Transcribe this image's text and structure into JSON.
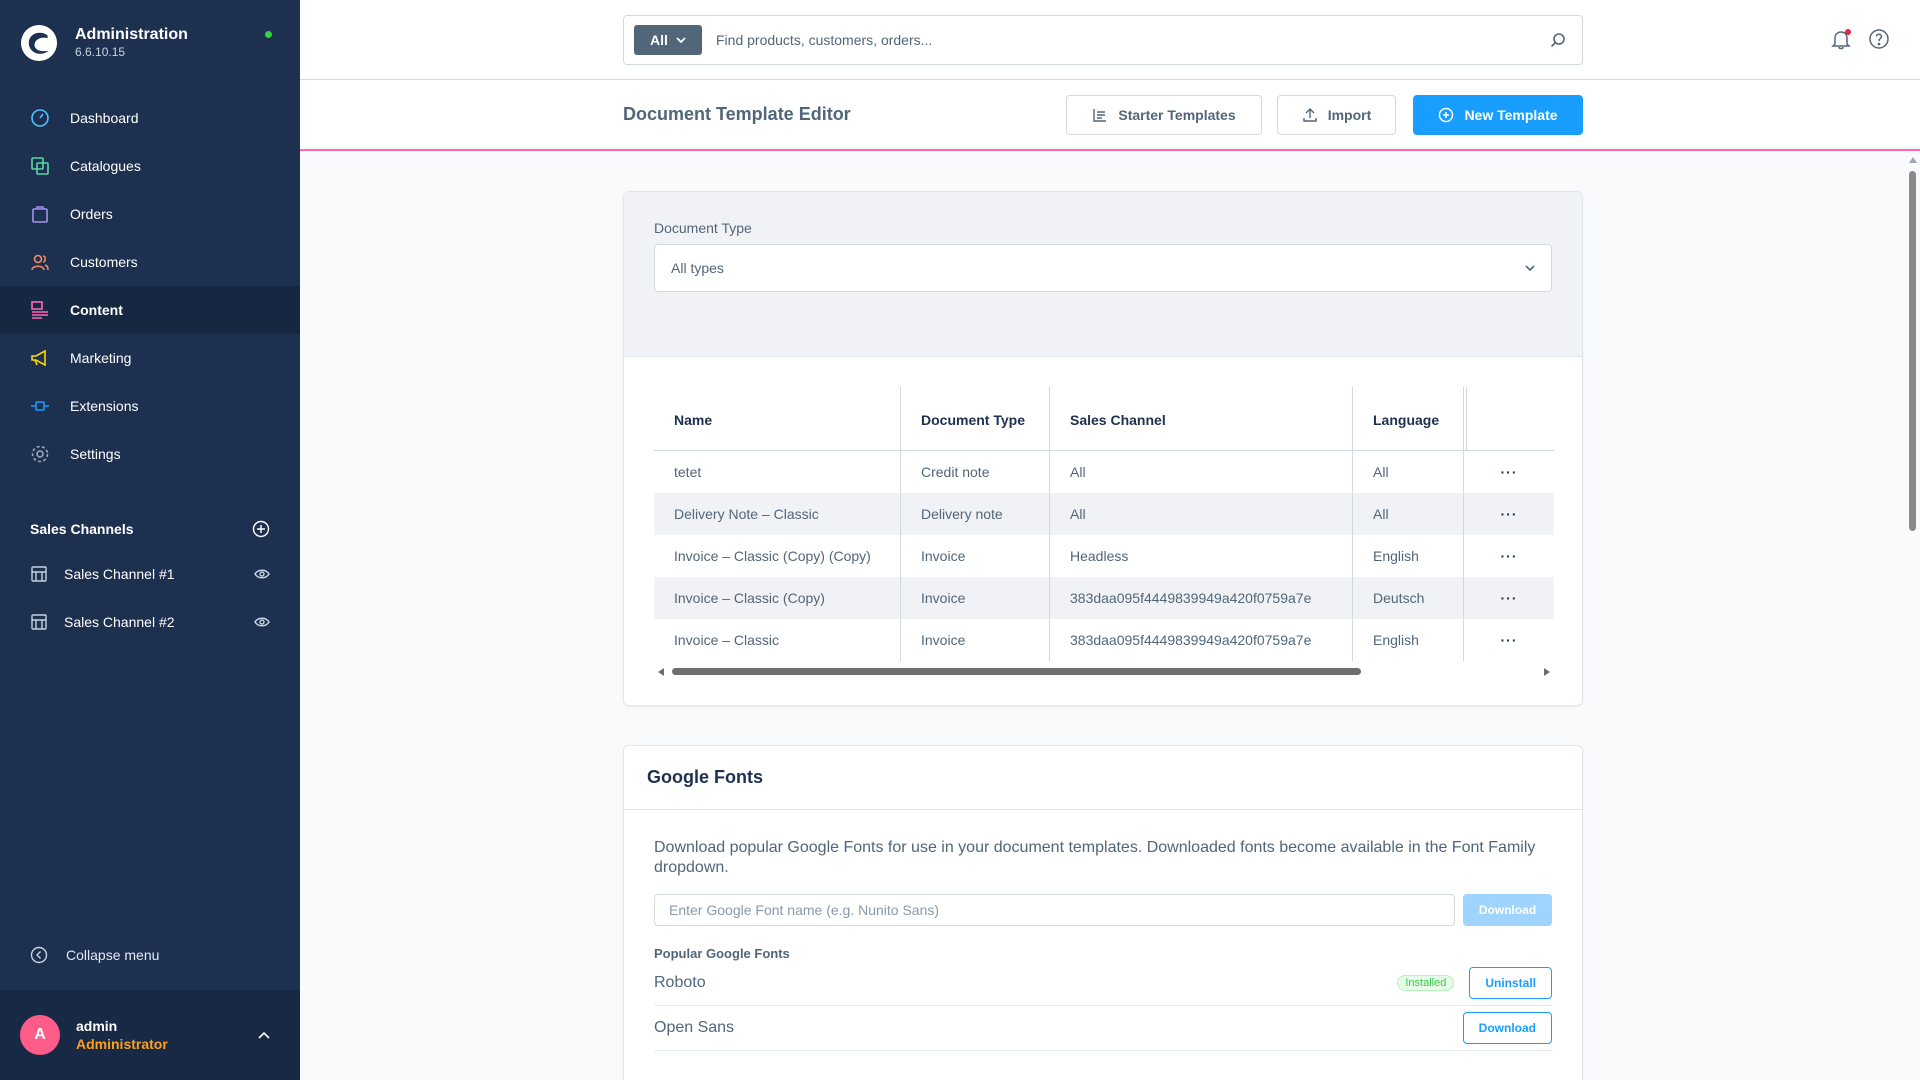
{
  "app": {
    "title": "Administration",
    "version": "6.6.10.15"
  },
  "nav": [
    {
      "label": "Dashboard",
      "icon": "gauge-icon",
      "color": "#4fc3ff"
    },
    {
      "label": "Catalogues",
      "icon": "products-icon",
      "color": "#57d9a3"
    },
    {
      "label": "Orders",
      "icon": "shopping-bag-icon",
      "color": "#a092f0"
    },
    {
      "label": "Customers",
      "icon": "users-icon",
      "color": "#f88962"
    },
    {
      "label": "Content",
      "icon": "content-icon",
      "color": "#ff68b4",
      "active": true
    },
    {
      "label": "Marketing",
      "icon": "megaphone-icon",
      "color": "#ffd700"
    },
    {
      "label": "Extensions",
      "icon": "plug-icon",
      "color": "#189eff"
    },
    {
      "label": "Settings",
      "icon": "gear-icon",
      "color": "#9aa8b5"
    }
  ],
  "sales_channels": {
    "title": "Sales Channels",
    "items": [
      {
        "label": "Sales Channel #1"
      },
      {
        "label": "Sales Channel #2"
      }
    ]
  },
  "collapse_label": "Collapse menu",
  "user": {
    "initial": "A",
    "name": "admin",
    "role": "Administrator"
  },
  "search": {
    "type": "All",
    "placeholder": "Find products, customers, orders..."
  },
  "smartbar": {
    "title": "Document Template Editor",
    "starter_label": "Starter Templates",
    "import_label": "Import",
    "new_label": "New Template"
  },
  "filter": {
    "label": "Document Type",
    "value": "All types"
  },
  "table": {
    "columns": [
      "Name",
      "Document Type",
      "Sales Channel",
      "Language"
    ],
    "rows": [
      {
        "name": "tetet",
        "type": "Credit note",
        "channel": "All",
        "language": "All"
      },
      {
        "name": "Delivery Note – Classic",
        "type": "Delivery note",
        "channel": "All",
        "language": "All"
      },
      {
        "name": "Invoice – Classic (Copy) (Copy)",
        "type": "Invoice",
        "channel": "Headless",
        "language": "English"
      },
      {
        "name": "Invoice – Classic (Copy)",
        "type": "Invoice",
        "channel": "383daa095f4449839949a420f0759a7e",
        "language": "Deutsch"
      },
      {
        "name": "Invoice – Classic",
        "type": "Invoice",
        "channel": "383daa095f4449839949a420f0759a7e",
        "language": "English"
      }
    ],
    "row_action": "···"
  },
  "fonts": {
    "title": "Google Fonts",
    "description": "Download popular Google Fonts for use in your document templates. Downloaded fonts become available in the Font Family dropdown.",
    "input_placeholder": "Enter Google Font name (e.g. Nunito Sans)",
    "download_label": "Download",
    "popular_title": "Popular Google Fonts",
    "items": [
      {
        "name": "Roboto",
        "status": "Installed",
        "action": "Uninstall"
      },
      {
        "name": "Open Sans",
        "action": "Download"
      }
    ]
  }
}
